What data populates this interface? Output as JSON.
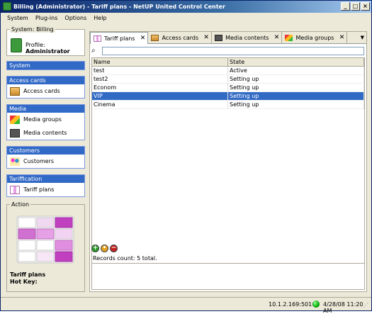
{
  "window": {
    "title": "Billing (Administrator) - Tariff plans - NetUP United Control Center"
  },
  "menubar": [
    "System",
    "Plug-ins",
    "Options",
    "Help"
  ],
  "sidebar": {
    "system_legend": "System: Billing",
    "profile_label": "Profile:",
    "profile_value": "Administrator",
    "sections": [
      {
        "header": "System",
        "items": []
      },
      {
        "header": "Access cards",
        "items": [
          {
            "label": "Access cards"
          }
        ]
      },
      {
        "header": "Media",
        "items": [
          {
            "label": "Media groups"
          },
          {
            "label": "Media contents"
          }
        ]
      },
      {
        "header": "Customers",
        "items": [
          {
            "label": "Customers"
          }
        ]
      },
      {
        "header": "Tariffication",
        "items": [
          {
            "label": "Tariff plans"
          }
        ]
      }
    ],
    "action_legend": "Action",
    "action_name": "Tariff plans",
    "action_hotkey": "Hot Key:"
  },
  "tabs": [
    {
      "label": "Tariff plans",
      "active": true
    },
    {
      "label": "Access cards",
      "active": false
    },
    {
      "label": "Media contents",
      "active": false
    },
    {
      "label": "Media groups",
      "active": false
    }
  ],
  "grid": {
    "columns": [
      "Name",
      "State"
    ],
    "rows": [
      {
        "name": "test",
        "state": "Active",
        "selected": false
      },
      {
        "name": "test2",
        "state": "Setting up",
        "selected": false
      },
      {
        "name": "Econom",
        "state": "Setting up",
        "selected": false
      },
      {
        "name": "VIP",
        "state": "Setting up",
        "selected": true
      },
      {
        "name": "Cinema",
        "state": "Setting up",
        "selected": false
      }
    ]
  },
  "records_count": "Records count: 5 total.",
  "status": {
    "address": "10.1.2.169:50100",
    "datetime": "4/28/08 11:20 AM"
  }
}
